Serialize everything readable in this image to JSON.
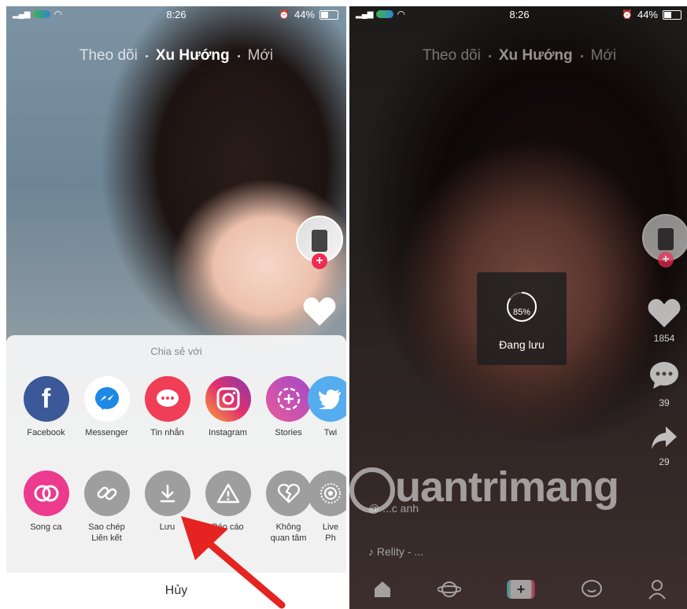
{
  "left": {
    "status": {
      "time": "8:26",
      "battery": "44%",
      "battery_fraction": 0.44
    },
    "nav": {
      "following": "Theo dõi",
      "trending": "Xu Hướng",
      "new": "Mới"
    },
    "share_sheet": {
      "title": "Chia sẻ với",
      "row1": [
        {
          "label": "Facebook",
          "icon": "facebook-icon",
          "color": "#3b5998"
        },
        {
          "label": "Messenger",
          "icon": "messenger-icon",
          "color": "#ffffff"
        },
        {
          "label": "Tin nhắn",
          "icon": "message-icon",
          "color": "#ef3e55"
        },
        {
          "label": "Instagram",
          "icon": "instagram-icon",
          "color": "#c1358a"
        },
        {
          "label": "Stories",
          "icon": "stories-icon",
          "color": "#a347c9"
        },
        {
          "label": "Twi",
          "icon": "twitter-icon",
          "color": "#55acee"
        }
      ],
      "row2": [
        {
          "label": "Song ca",
          "icon": "duet-icon",
          "color": "#ec3a8e"
        },
        {
          "label": "Sao chép\nLiên kết",
          "icon": "link-icon",
          "color": "#9e9e9e"
        },
        {
          "label": "Lưu",
          "icon": "download-icon",
          "color": "#9e9e9e"
        },
        {
          "label": "Báo cáo",
          "icon": "warning-icon",
          "color": "#9e9e9e"
        },
        {
          "label": "Không\nquan tâm",
          "icon": "broken-heart-icon",
          "color": "#9e9e9e"
        },
        {
          "label": "Live Ph",
          "icon": "live-photo-icon",
          "color": "#9e9e9e"
        }
      ],
      "cancel": "Hủy"
    }
  },
  "right": {
    "status": {
      "time": "8:26",
      "battery": "44%",
      "battery_fraction": 0.44
    },
    "nav": {
      "following": "Theo dõi",
      "trending": "Xu Hướng",
      "new": "Mới"
    },
    "saving": {
      "percent_label": "85%",
      "percent": 85,
      "text": "Đang lưu"
    },
    "counts": {
      "likes": "1854",
      "comments": "39",
      "shares": "29"
    },
    "caption_user": "@ ...c anh",
    "caption_song": "Relity - ...",
    "watermark": "uantrimang"
  }
}
